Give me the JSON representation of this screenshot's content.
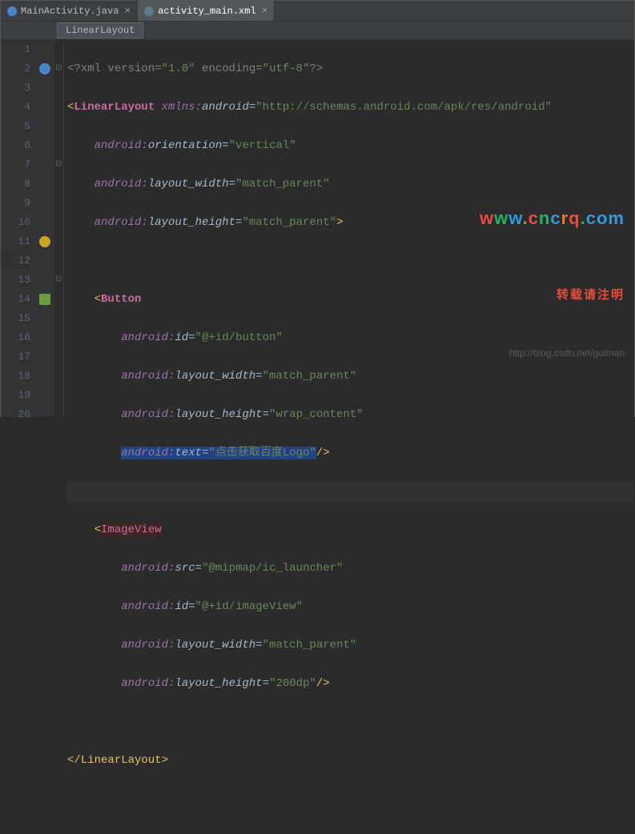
{
  "tabs": [
    {
      "label": "MainActivity.java",
      "iconColor": "#4a86c7",
      "active": false
    },
    {
      "label": "activity_main.xml",
      "iconColor": "#c27ba0",
      "active": true
    }
  ],
  "breadcrumb": "LinearLayout",
  "gutter": {
    "lines": [
      "1",
      "2",
      "3",
      "4",
      "5",
      "6",
      "7",
      "8",
      "9",
      "10",
      "11",
      "12",
      "13",
      "14",
      "15",
      "16",
      "17",
      "18",
      "19",
      "20"
    ],
    "icons": [
      {
        "line": 2,
        "color": "#4a86c7",
        "name": "class-icon"
      },
      {
        "line": 11,
        "color": "#c9a227",
        "name": "lightbulb-icon"
      },
      {
        "line": 14,
        "color": "#6a9e3f",
        "name": "android-icon"
      }
    ]
  },
  "code": {
    "l1": {
      "pi": "<?",
      "pibody": "xml version=",
      "v1": "\"1.0\"",
      "enc": " encoding=",
      "v2": "\"utf-8\"",
      "piend": "?>"
    },
    "l2": {
      "tag": "LinearLayout",
      "ns": "xmlns:",
      "nsname": "android",
      "val": "\"http://schemas.android.com/apk/res/android\""
    },
    "l3": {
      "ns": "android:",
      "attr": "orientation",
      "val": "\"vertical\""
    },
    "l4": {
      "ns": "android:",
      "attr": "layout_width",
      "val": "\"match_parent\""
    },
    "l5": {
      "ns": "android:",
      "attr": "layout_height",
      "val": "\"match_parent\""
    },
    "l7": {
      "tag": "Button"
    },
    "l8": {
      "ns": "android:",
      "attr": "id",
      "val": "\"@+id/button\""
    },
    "l9": {
      "ns": "android:",
      "attr": "layout_width",
      "val": "\"match_parent\""
    },
    "l10": {
      "ns": "android:",
      "attr": "layout_height",
      "val": "\"wrap_content\""
    },
    "l11": {
      "ns": "android:",
      "attr": "text",
      "val": "\"点击获取百度Logo\""
    },
    "l13": {
      "tag": "ImageView"
    },
    "l14": {
      "ns": "android:",
      "attr": "src",
      "val": "\"@mipmap/ic_launcher\""
    },
    "l15": {
      "ns": "android:",
      "attr": "id",
      "val": "\"@+id/imageView\""
    },
    "l16": {
      "ns": "android:",
      "attr": "layout_width",
      "val": "\"match_parent\""
    },
    "l17": {
      "ns": "android:",
      "attr": "layout_height",
      "val": "\"200dp\""
    },
    "l19": {
      "tag": "LinearLayout"
    }
  },
  "watermark": {
    "url_w1": "w",
    "url_w2": "w",
    "url_w3": "w",
    "url_dot1": ".",
    "url_c": "c",
    "url_n": "n",
    "url_c2": "c",
    "url_r": "r",
    "url_q": "q",
    "url_dot2": ".",
    "url_com": "com",
    "line2": "转载请注明",
    "line3": "http://blog.csdn.net/guiman"
  }
}
